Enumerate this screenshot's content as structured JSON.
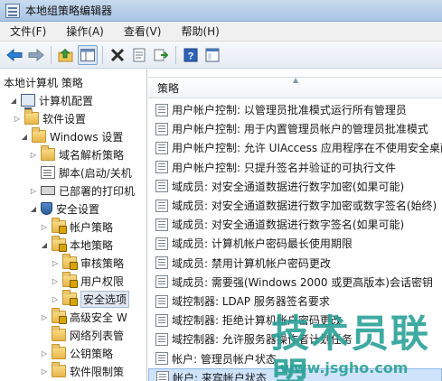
{
  "window": {
    "title": "本地组策略编辑器"
  },
  "menu": [
    "文件(F)",
    "操作(A)",
    "查看(V)",
    "帮助(H)"
  ],
  "toolbar": {
    "buttons": [
      "back-icon",
      "forward-icon",
      "up-folder-icon",
      "show-hide-tree-icon",
      "delete-icon",
      "properties-icon",
      "export-icon",
      "help-icon",
      "console-icon"
    ]
  },
  "tree": [
    {
      "label": "本地计算机 策略",
      "icon": "none",
      "expander": ""
    },
    {
      "label": "计算机配置",
      "icon": "computer",
      "expander": "open"
    },
    {
      "label": "软件设置",
      "icon": "folder",
      "expander": "closed"
    },
    {
      "label": "Windows 设置",
      "icon": "folder",
      "expander": "open"
    },
    {
      "label": "域名解析策略",
      "icon": "folder",
      "expander": "closed"
    },
    {
      "label": "脚本(启动/关机",
      "icon": "script",
      "expander": ""
    },
    {
      "label": "已部署的打印机",
      "icon": "printer",
      "expander": "closed"
    },
    {
      "label": "安全设置",
      "icon": "shield",
      "expander": "open"
    },
    {
      "label": "帐户策略",
      "icon": "lockfolder",
      "expander": "closed"
    },
    {
      "label": "本地策略",
      "icon": "lockfolder",
      "expander": "open"
    },
    {
      "label": "审核策略",
      "icon": "lockfolder",
      "expander": "closed"
    },
    {
      "label": "用户权限",
      "icon": "lockfolder",
      "expander": "closed"
    },
    {
      "label": "安全选项",
      "icon": "lockfolder",
      "expander": "closed",
      "selected": true
    },
    {
      "label": "高级安全 W",
      "icon": "lockfolder",
      "expander": "closed"
    },
    {
      "label": "网络列表管",
      "icon": "folder",
      "expander": ""
    },
    {
      "label": "公钥策略",
      "icon": "folder",
      "expander": "closed"
    },
    {
      "label": "软件限制策",
      "icon": "folder",
      "expander": "closed"
    }
  ],
  "list": {
    "column_header": "策略",
    "rows": [
      "用户帐户控制: 以管理员批准模式运行所有管理员",
      "用户帐户控制: 用于内置管理员帐户的管理员批准模式",
      "用户帐户控制: 允许 UIAccess 应用程序在不使用安全桌面",
      "用户帐户控制: 只提升签名并验证的可执行文件",
      "域成员: 对安全通道数据进行数字加密(如果可能)",
      "域成员: 对安全通道数据进行数字加密或数字签名(始终)",
      "域成员: 对安全通道数据进行数字签名(如果可能)",
      "域成员: 计算机帐户密码最长使用期限",
      "域成员: 禁用计算机帐户密码更改",
      "域成员: 需要强(Windows 2000 或更高版本)会话密钥",
      "域控制器: LDAP 服务器签名要求",
      "域控制器: 拒绝计算机帐户密码更改",
      "域控制器: 允许服务器操作者计划任务",
      "帐户: 管理员帐户状态",
      "帐户: 来宾帐户状态"
    ],
    "selected_index": 14
  },
  "watermark": {
    "text": "技术员联盟",
    "url": "www.jsgho.com"
  }
}
